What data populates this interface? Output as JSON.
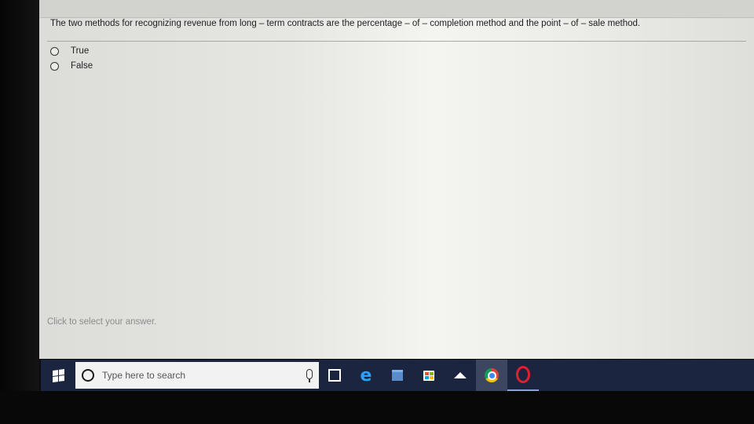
{
  "question": {
    "text": "The two methods for recognizing revenue from long – term contracts are the percentage – of – completion method and the point – of – sale method."
  },
  "options": [
    {
      "label": "True"
    },
    {
      "label": "False"
    }
  ],
  "hint": "Click to select your answer.",
  "taskbar": {
    "search_placeholder": "Type here to search",
    "icons": [
      "windows-start-icon",
      "search-icon",
      "microphone-icon",
      "task-view-icon",
      "edge-icon",
      "file-explorer-icon",
      "store-icon",
      "graduation-cap-icon",
      "chrome-icon",
      "opera-icon"
    ]
  }
}
